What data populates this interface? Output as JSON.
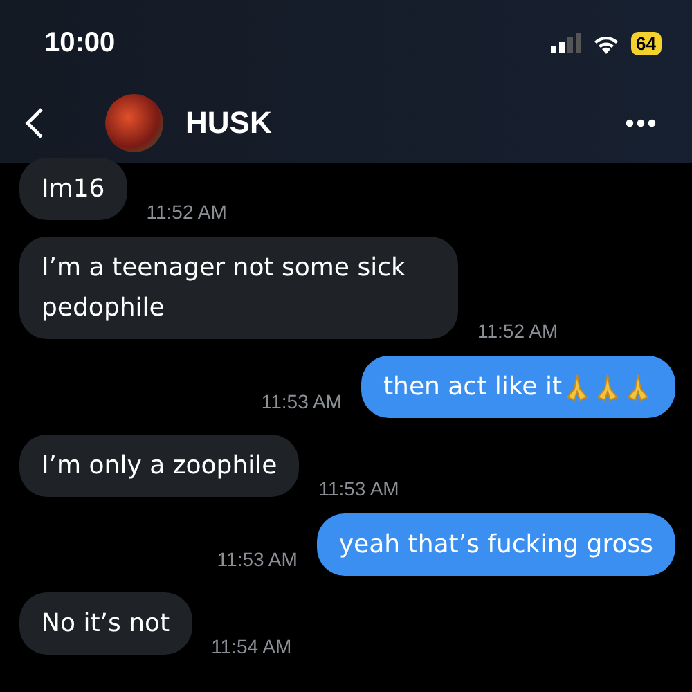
{
  "status_bar": {
    "time": "10:00",
    "battery": "64"
  },
  "header": {
    "name": "HUSK"
  },
  "messages": [
    {
      "kind": "received",
      "text": "Im16",
      "time": "11:52 AM"
    },
    {
      "kind": "received",
      "text": "I’m a teenager not some sick pedophile",
      "time": "11:52 AM"
    },
    {
      "kind": "sent",
      "text": "then act like it",
      "time": "11:53 AM",
      "icons": [
        {
          "kind": "praying-hands"
        },
        {
          "kind": "praying-hands"
        },
        {
          "kind": "praying-hands"
        }
      ]
    },
    {
      "kind": "received",
      "text": "I’m only a zoophile",
      "time": "11:53 AM"
    },
    {
      "kind": "sent",
      "text": "yeah that’s fucking gross",
      "time": "11:53 AM"
    },
    {
      "kind": "received",
      "text": "No it’s not",
      "time": "11:54 AM"
    }
  ]
}
